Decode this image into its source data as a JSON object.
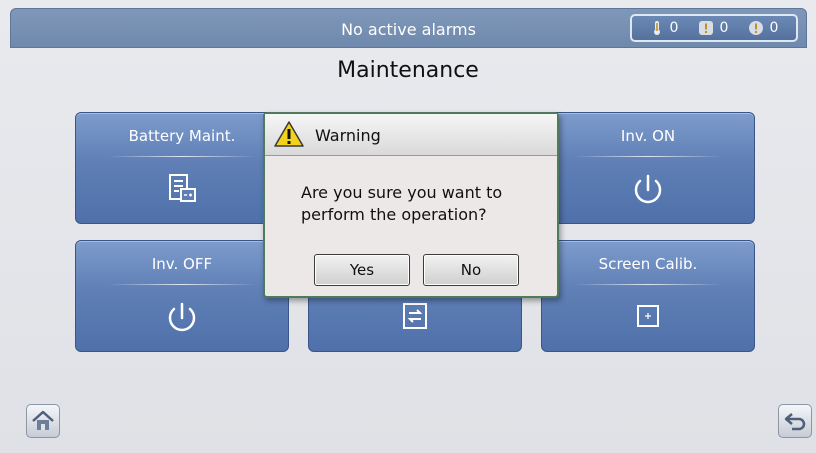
{
  "status_bar": {
    "alarm_text": "No active alarms",
    "counters": [
      {
        "icon": "critical-alarm-icon",
        "count": "0"
      },
      {
        "icon": "major-alarm-icon",
        "count": "0"
      },
      {
        "icon": "minor-alarm-icon",
        "count": "0"
      }
    ]
  },
  "page": {
    "title": "Maintenance"
  },
  "tiles": [
    {
      "label": "Battery Maint.",
      "icon": "battery-document-icon"
    },
    {
      "label": "Inv. ON",
      "icon": "power-icon"
    },
    {
      "label": "Inv. OFF",
      "icon": "power-icon"
    },
    {
      "label": "",
      "icon": "transfer-document-icon"
    },
    {
      "label": "Screen Calib.",
      "icon": "calibration-target-icon"
    }
  ],
  "dialog": {
    "title": "Warning",
    "message": "Are you sure you want to perform the operation?",
    "yes_label": "Yes",
    "no_label": "No"
  },
  "nav": {
    "home_icon": "home-icon",
    "back_icon": "back-icon"
  },
  "colors": {
    "tile_blue": "#5f7fb6",
    "status_bar": "#7791b5",
    "dialog_border": "#4f7a5c",
    "warning_yellow": "#f3d21c"
  }
}
